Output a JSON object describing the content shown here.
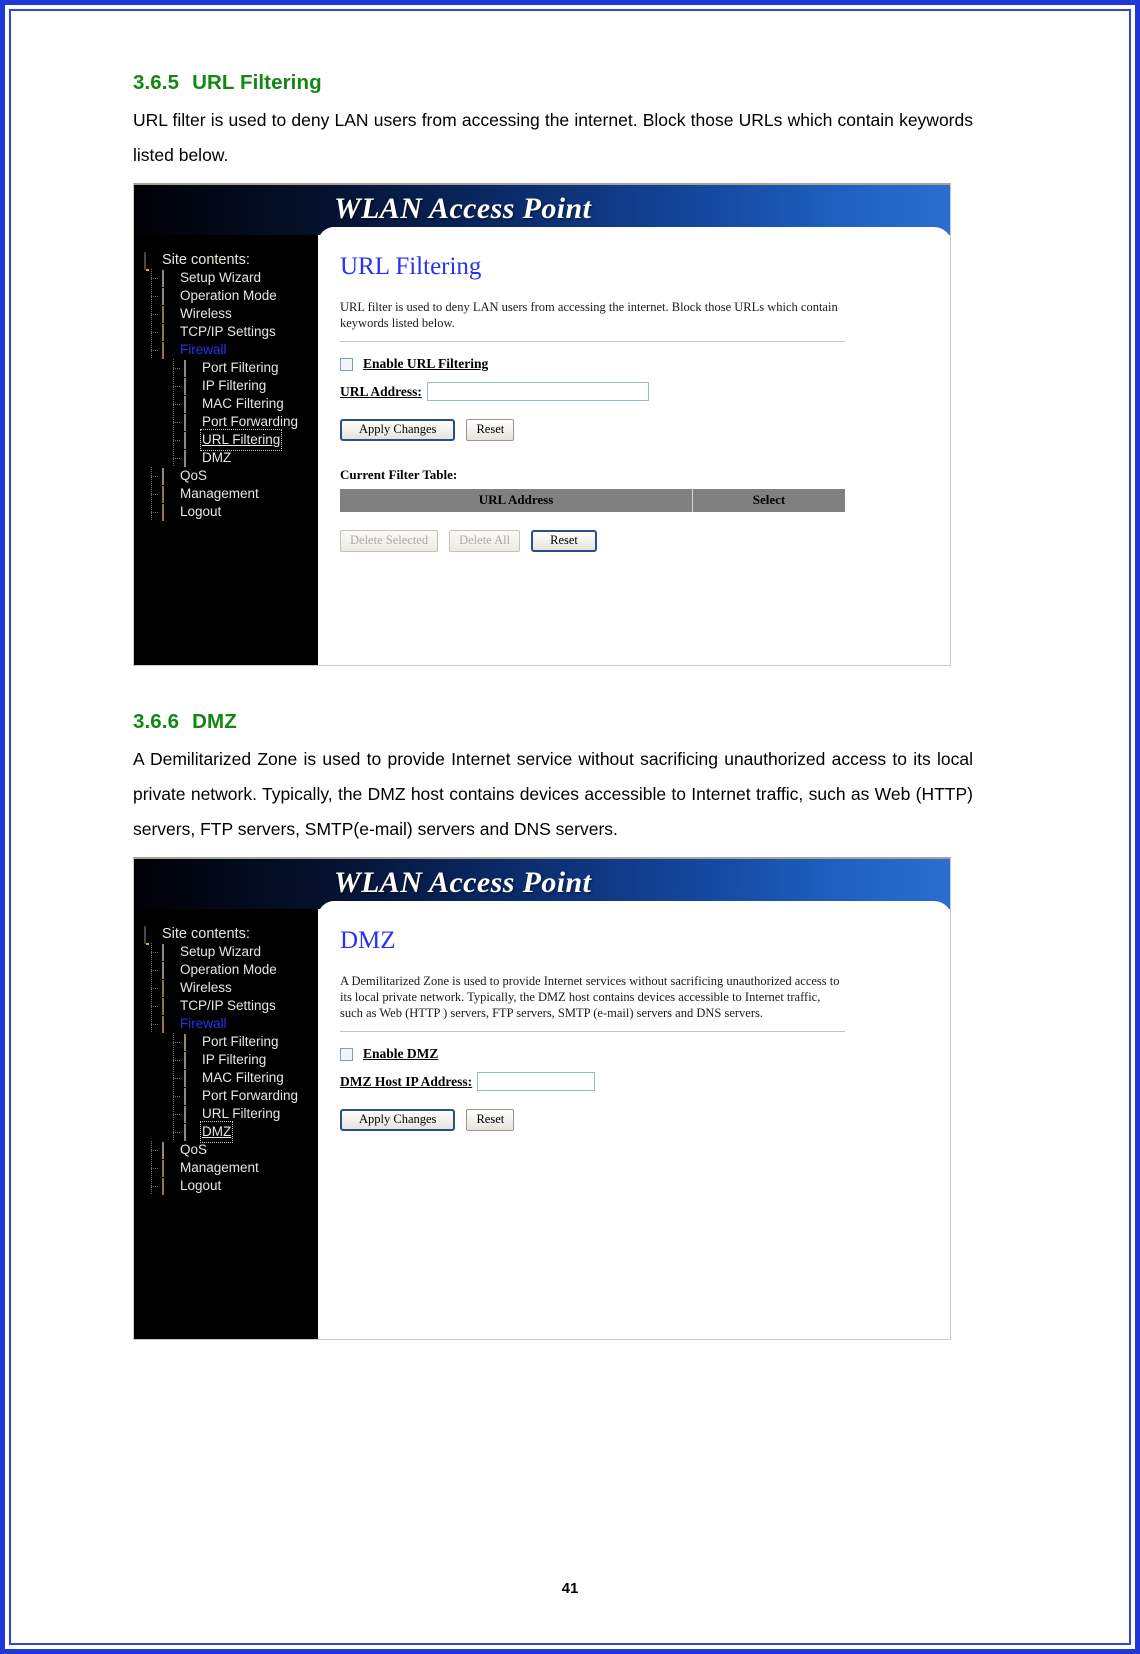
{
  "document": {
    "page_number": "41",
    "sections": [
      {
        "number": "3.6.5",
        "title": "URL Filtering",
        "body": "URL filter is used to deny LAN users from accessing the internet. Block those URLs which contain keywords listed below."
      },
      {
        "number": "3.6.6",
        "title": "DMZ",
        "body": "A Demilitarized Zone is used to provide Internet service without sacrificing unauthorized access to its local private network. Typically, the DMZ host contains devices accessible to Internet traffic, such as Web (HTTP) servers, FTP servers, SMTP(e-mail) servers and DNS servers."
      }
    ]
  },
  "colors": {
    "heading_green": "#118811",
    "panel_title_blue": "#2b31f0",
    "page_border_blue": "#1f39d8",
    "banner_blue": "#14489f",
    "table_header_gray": "#808080"
  },
  "screenshots": [
    {
      "banner_title": "WLAN Access Point",
      "sidebar": {
        "root_label": "Site contents:",
        "root_icon": "site-contents-icon",
        "items": [
          {
            "label": "Setup Wizard",
            "icon": "document-icon",
            "level": 1,
            "state": "normal"
          },
          {
            "label": "Operation Mode",
            "icon": "document-icon",
            "level": 1,
            "state": "normal"
          },
          {
            "label": "Wireless",
            "icon": "folder-icon",
            "level": 1,
            "state": "normal"
          },
          {
            "label": "TCP/IP Settings",
            "icon": "folder-icon",
            "level": 1,
            "state": "normal"
          },
          {
            "label": "Firewall",
            "icon": "folder-open-icon",
            "level": 1,
            "state": "open"
          },
          {
            "label": "Port Filtering",
            "icon": "document-icon",
            "level": 2,
            "state": "normal"
          },
          {
            "label": "IP Filtering",
            "icon": "document-icon",
            "level": 2,
            "state": "normal"
          },
          {
            "label": "MAC Filtering",
            "icon": "document-icon",
            "level": 2,
            "state": "normal"
          },
          {
            "label": "Port Forwarding",
            "icon": "document-icon",
            "level": 2,
            "state": "normal"
          },
          {
            "label": "URL Filtering",
            "icon": "document-icon",
            "level": 2,
            "state": "selected"
          },
          {
            "label": "DMZ",
            "icon": "document-icon",
            "level": 2,
            "state": "normal"
          },
          {
            "label": "QoS",
            "icon": "document-icon",
            "level": 1,
            "state": "normal"
          },
          {
            "label": "Management",
            "icon": "folder-icon",
            "level": 1,
            "state": "normal"
          },
          {
            "label": "Logout",
            "icon": "folder-icon",
            "level": 1,
            "state": "normal"
          }
        ]
      },
      "panel": {
        "title": "URL Filtering",
        "description": "URL filter is used to deny LAN users from accessing the internet. Block those URLs which contain keywords listed below.",
        "enable_checkbox_label": "Enable URL Filtering",
        "enable_checkbox_checked": false,
        "field_label": "URL Address",
        "field_value": "",
        "apply_label": "Apply Changes",
        "reset_label": "Reset",
        "table_caption": "Current Filter Table:",
        "table_headers": [
          "URL Address",
          "Select"
        ],
        "table_rows": [],
        "delete_selected_label": "Delete Selected",
        "delete_selected_enabled": false,
        "delete_all_label": "Delete All",
        "delete_all_enabled": false,
        "table_reset_label": "Reset"
      }
    },
    {
      "banner_title": "WLAN Access Point",
      "sidebar": {
        "root_label": "Site contents:",
        "root_icon": "site-contents-icon",
        "items": [
          {
            "label": "Setup Wizard",
            "icon": "document-icon",
            "level": 1,
            "state": "normal"
          },
          {
            "label": "Operation Mode",
            "icon": "document-icon",
            "level": 1,
            "state": "normal"
          },
          {
            "label": "Wireless",
            "icon": "folder-icon",
            "level": 1,
            "state": "normal"
          },
          {
            "label": "TCP/IP Settings",
            "icon": "folder-icon",
            "level": 1,
            "state": "normal"
          },
          {
            "label": "Firewall",
            "icon": "folder-open-icon",
            "level": 1,
            "state": "open"
          },
          {
            "label": "Port Filtering",
            "icon": "document-icon",
            "level": 2,
            "state": "normal"
          },
          {
            "label": "IP Filtering",
            "icon": "document-icon",
            "level": 2,
            "state": "normal"
          },
          {
            "label": "MAC Filtering",
            "icon": "document-icon",
            "level": 2,
            "state": "normal"
          },
          {
            "label": "Port Forwarding",
            "icon": "document-icon",
            "level": 2,
            "state": "normal"
          },
          {
            "label": "URL Filtering",
            "icon": "document-icon",
            "level": 2,
            "state": "normal"
          },
          {
            "label": "DMZ",
            "icon": "document-icon",
            "level": 2,
            "state": "selected"
          },
          {
            "label": "QoS",
            "icon": "document-icon",
            "level": 1,
            "state": "normal"
          },
          {
            "label": "Management",
            "icon": "folder-icon",
            "level": 1,
            "state": "normal"
          },
          {
            "label": "Logout",
            "icon": "folder-icon",
            "level": 1,
            "state": "normal"
          }
        ]
      },
      "panel": {
        "title": "DMZ",
        "description": "A Demilitarized Zone is used to provide Internet services without sacrificing unauthorized access to its local private network. Typically, the DMZ host contains devices accessible to Internet traffic, such as Web (HTTP ) servers, FTP servers, SMTP (e-mail) servers and DNS servers.",
        "enable_checkbox_label": "Enable DMZ",
        "enable_checkbox_checked": false,
        "field_label": "DMZ Host IP Address",
        "field_value": "",
        "apply_label": "Apply Changes",
        "reset_label": "Reset"
      }
    }
  ]
}
